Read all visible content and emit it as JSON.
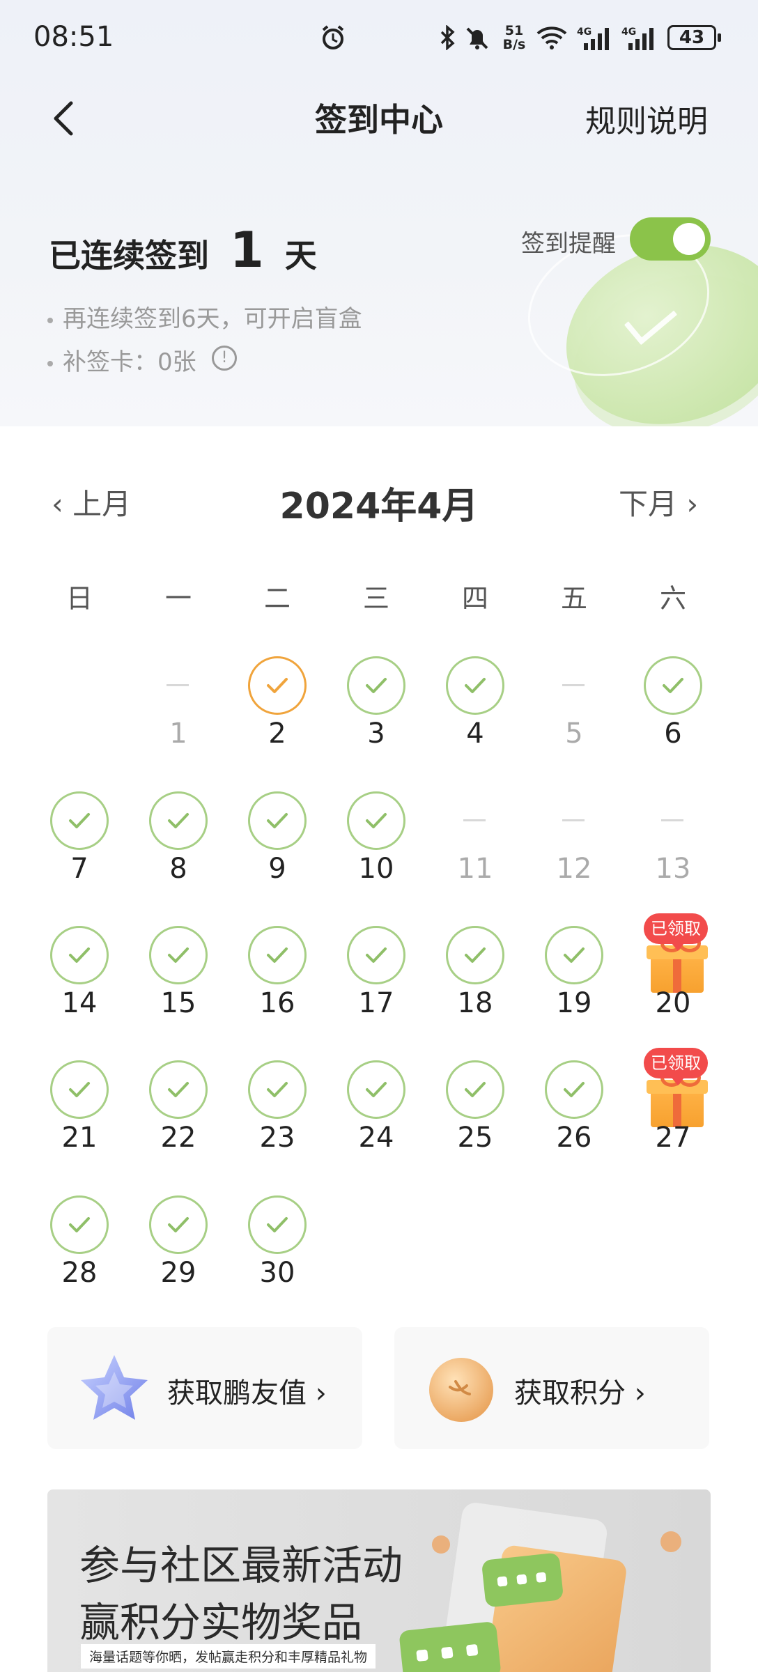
{
  "status_bar": {
    "time": "08:51",
    "speed_value": "51",
    "speed_unit": "B/s",
    "net1": "4G",
    "net2": "4G",
    "battery": "43"
  },
  "header": {
    "title": "签到中心",
    "rules_label": "规则说明"
  },
  "streak": {
    "prefix": "已连续签到",
    "days": "1",
    "suffix": "天",
    "reminder_label": "签到提醒",
    "reminder_on": true,
    "bullets": [
      "再连续签到6天，可开启盲盒",
      "补签卡：0张"
    ]
  },
  "calendar": {
    "prev_label": "上月",
    "next_label": "下月",
    "month_title": "2024年4月",
    "weekdays": [
      "日",
      "一",
      "二",
      "三",
      "四",
      "五",
      "六"
    ],
    "gift_badge": "已领取",
    "days": [
      {
        "day": "1",
        "status": "missed"
      },
      {
        "day": "2",
        "status": "today"
      },
      {
        "day": "3",
        "status": "signed"
      },
      {
        "day": "4",
        "status": "signed"
      },
      {
        "day": "5",
        "status": "missed"
      },
      {
        "day": "6",
        "status": "signed"
      },
      {
        "day": "7",
        "status": "signed"
      },
      {
        "day": "8",
        "status": "signed"
      },
      {
        "day": "9",
        "status": "signed"
      },
      {
        "day": "10",
        "status": "signed"
      },
      {
        "day": "11",
        "status": "future"
      },
      {
        "day": "12",
        "status": "future"
      },
      {
        "day": "13",
        "status": "future"
      },
      {
        "day": "14",
        "status": "signed"
      },
      {
        "day": "15",
        "status": "signed"
      },
      {
        "day": "16",
        "status": "signed"
      },
      {
        "day": "17",
        "status": "signed"
      },
      {
        "day": "18",
        "status": "signed"
      },
      {
        "day": "19",
        "status": "signed"
      },
      {
        "day": "20",
        "status": "gift"
      },
      {
        "day": "21",
        "status": "signed"
      },
      {
        "day": "22",
        "status": "signed"
      },
      {
        "day": "23",
        "status": "signed"
      },
      {
        "day": "24",
        "status": "signed"
      },
      {
        "day": "25",
        "status": "signed"
      },
      {
        "day": "26",
        "status": "signed"
      },
      {
        "day": "27",
        "status": "gift"
      },
      {
        "day": "28",
        "status": "signed"
      },
      {
        "day": "29",
        "status": "signed"
      },
      {
        "day": "30",
        "status": "signed"
      }
    ]
  },
  "cards": {
    "friend_value": "获取鹏友值",
    "points": "获取积分"
  },
  "banner": {
    "line1": "参与社区最新活动",
    "line2": "赢积分实物奖品",
    "caption": "海量话题等你晒，发帖赢走积分和丰厚精品礼物"
  },
  "colors": {
    "accent_green": "#8bc34a",
    "check_green": "#a7cf85",
    "today_orange": "#f0a43c",
    "badge_red": "#f24b4b"
  }
}
